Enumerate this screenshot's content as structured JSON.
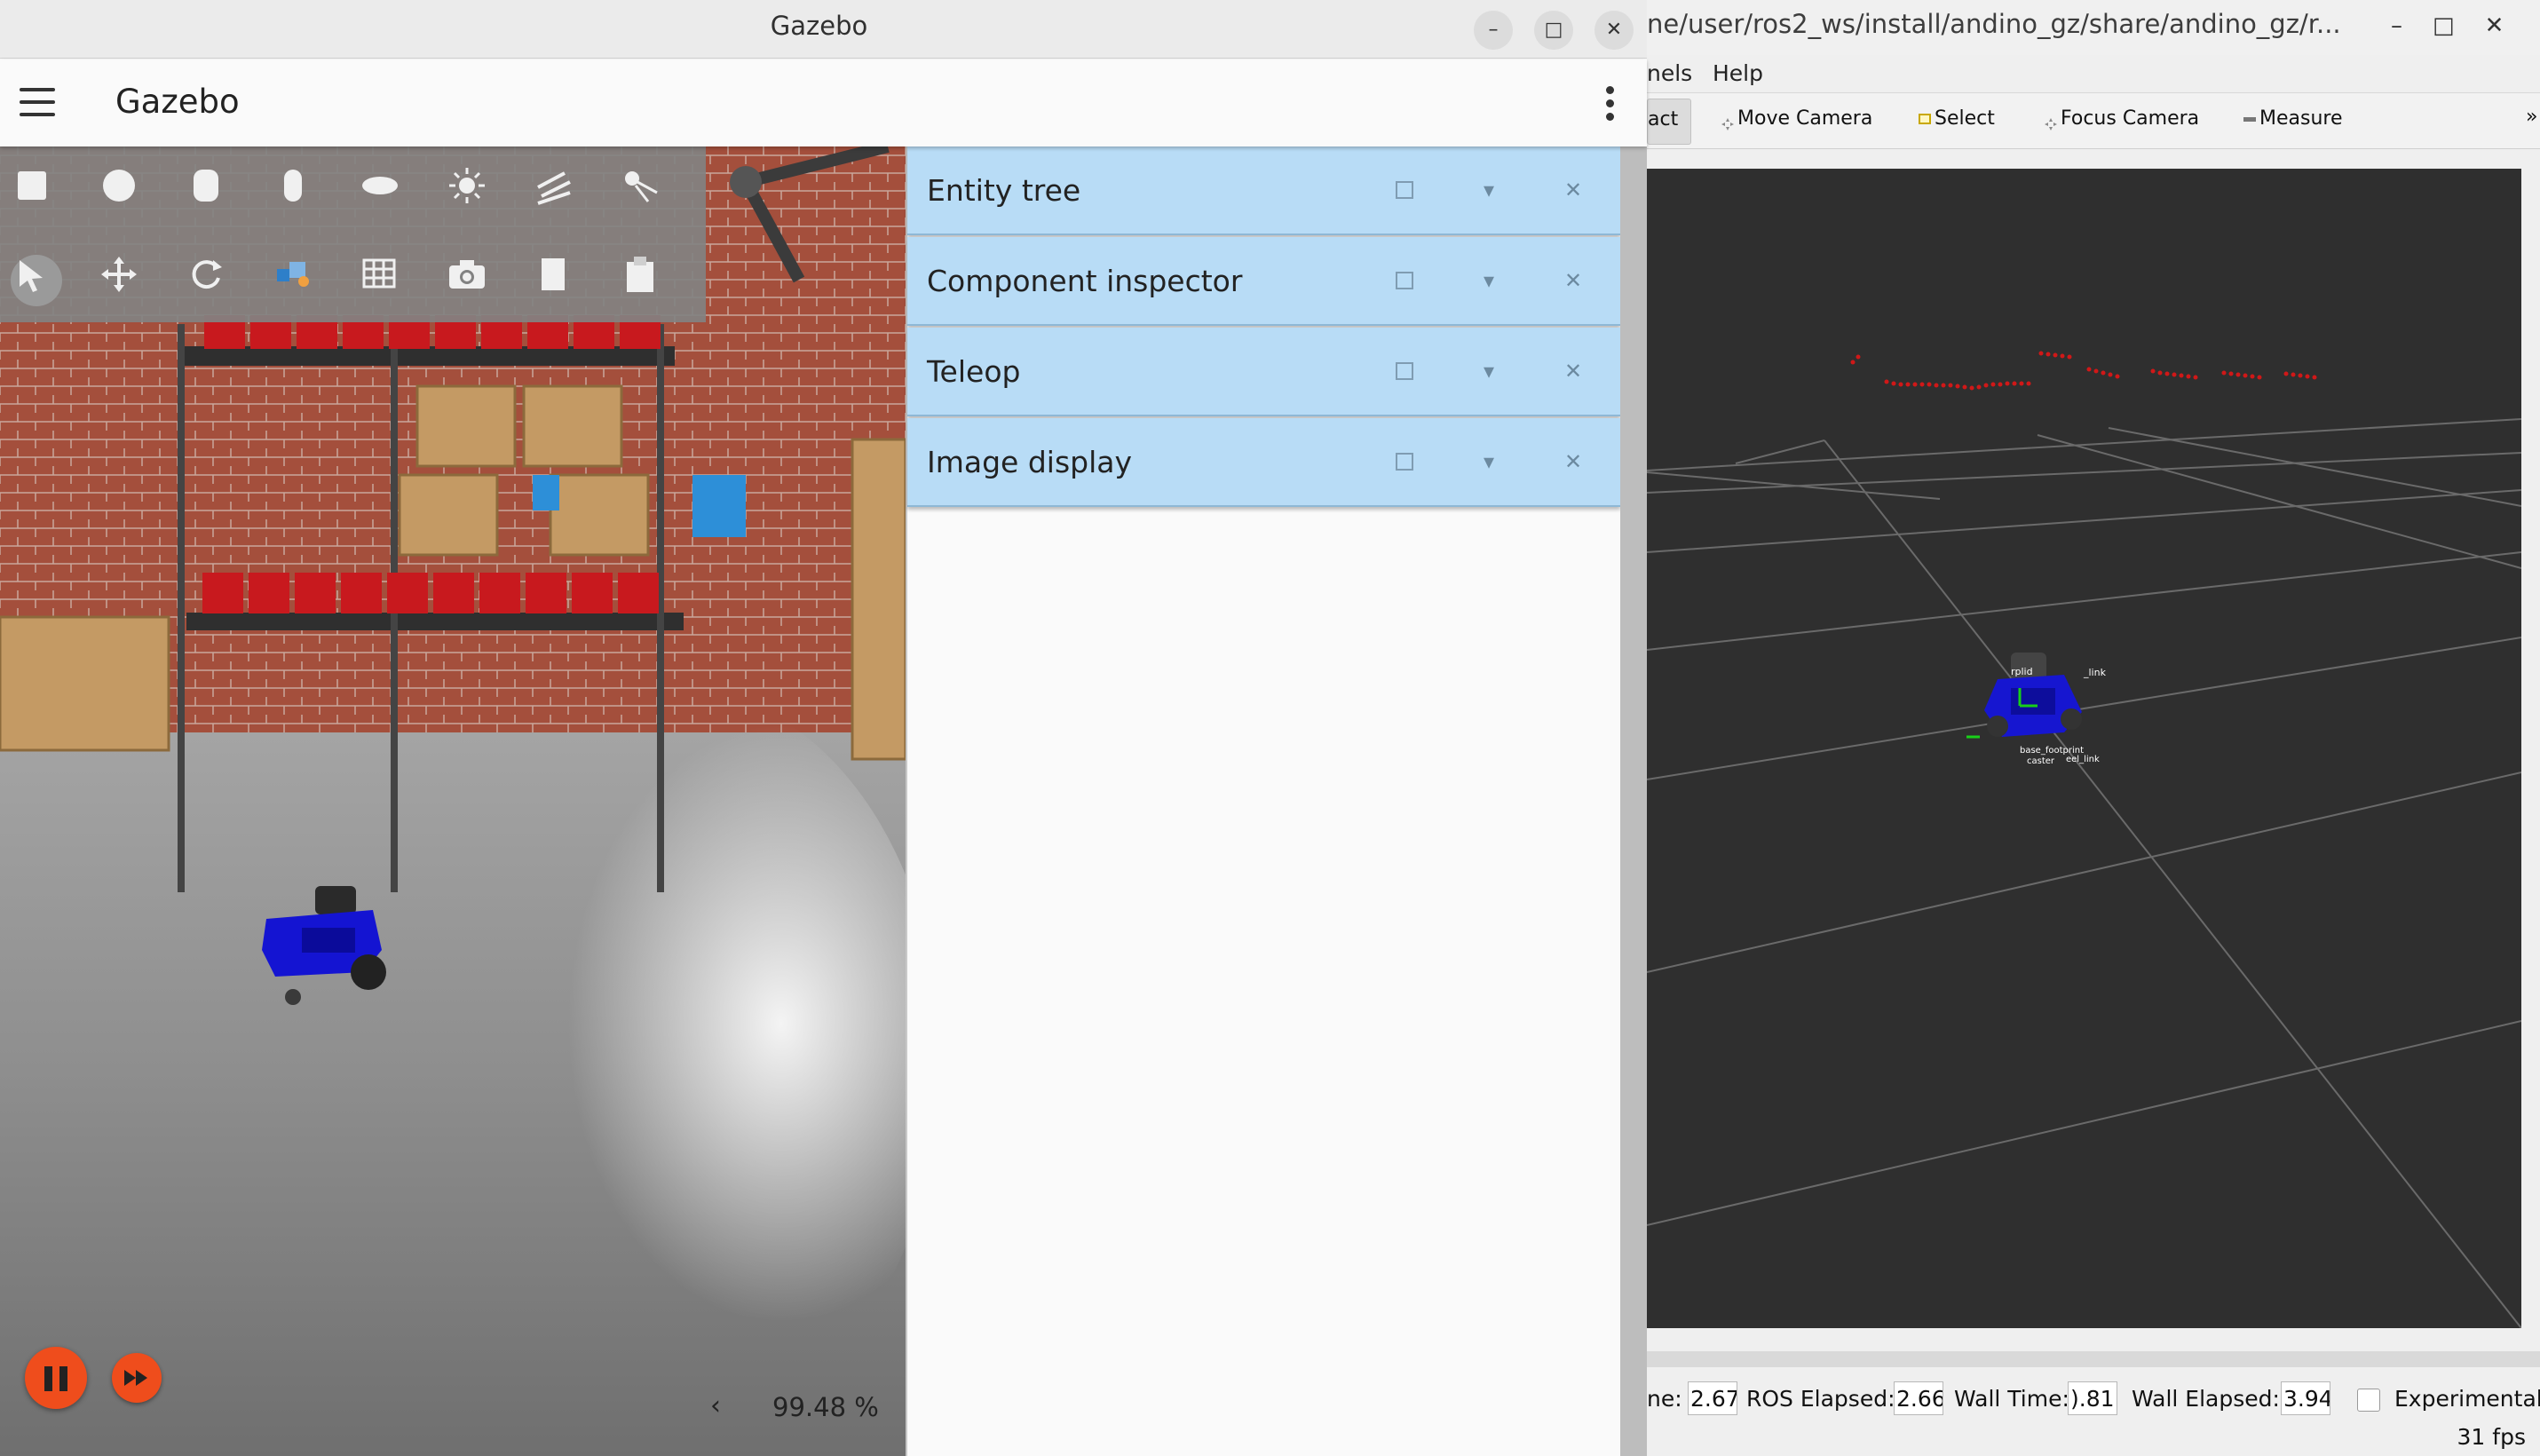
{
  "rviz": {
    "title": "ne/user/ros2_ws/install/andino_gz/share/andino_gz/r...",
    "window_buttons": [
      "–",
      "□",
      "✕"
    ],
    "menus": [
      "nels",
      "Help"
    ],
    "tools": [
      {
        "label": "act",
        "icon": "interact-icon"
      },
      {
        "label": "Move Camera",
        "icon": "move-camera-icon"
      },
      {
        "label": "Select",
        "icon": "select-icon"
      },
      {
        "label": "Focus Camera",
        "icon": "focus-camera-icon"
      },
      {
        "label": "Measure",
        "icon": "measure-icon"
      }
    ],
    "overflow": "»",
    "robot_labels": [
      "rplid",
      "_link",
      "base_footprint",
      "caster",
      "eel_link"
    ],
    "status": {
      "ros_time_label": "ne:",
      "ros_time_value": "2.67",
      "ros_elapsed_label": "ROS Elapsed:",
      "ros_elapsed_value": "2.66",
      "wall_time_label": "Wall Time:",
      "wall_time_value": ").81",
      "wall_elapsed_label": "Wall Elapsed:",
      "wall_elapsed_value": "3.94",
      "experimental_label": "Experimental",
      "experimental_checked": false
    },
    "fps": "31 fps"
  },
  "gazebo": {
    "window_title": "Gazebo",
    "window_buttons": [
      "–",
      "□",
      "✕"
    ],
    "app_title": "Gazebo",
    "toolbar_row1": [
      "box-shape-icon",
      "sphere-shape-icon",
      "cylinder-shape-icon",
      "capsule-shape-icon",
      "ellipsoid-shape-icon",
      "point-light-icon",
      "directional-light-icon",
      "spot-light-icon"
    ],
    "toolbar_row2": [
      "select-mode-icon",
      "translate-mode-icon",
      "rotate-mode-icon",
      "view-angle-icon",
      "grid-config-icon",
      "screenshot-icon",
      "copy-icon",
      "paste-icon"
    ],
    "plugins": [
      {
        "title": "Entity tree"
      },
      {
        "title": "Component inspector"
      },
      {
        "title": "Teleop"
      },
      {
        "title": "Image display"
      }
    ],
    "plugin_buttons": {
      "float": "□",
      "collapse": "▾",
      "close": "✕"
    },
    "rtf_toggle": "‹",
    "real_time_factor": "99.48 %",
    "playing": true
  },
  "colors": {
    "accent": "#ef4d1c",
    "panel_header": "#b8dcf6",
    "robot": "#1414d2",
    "laser": "#d01818"
  }
}
